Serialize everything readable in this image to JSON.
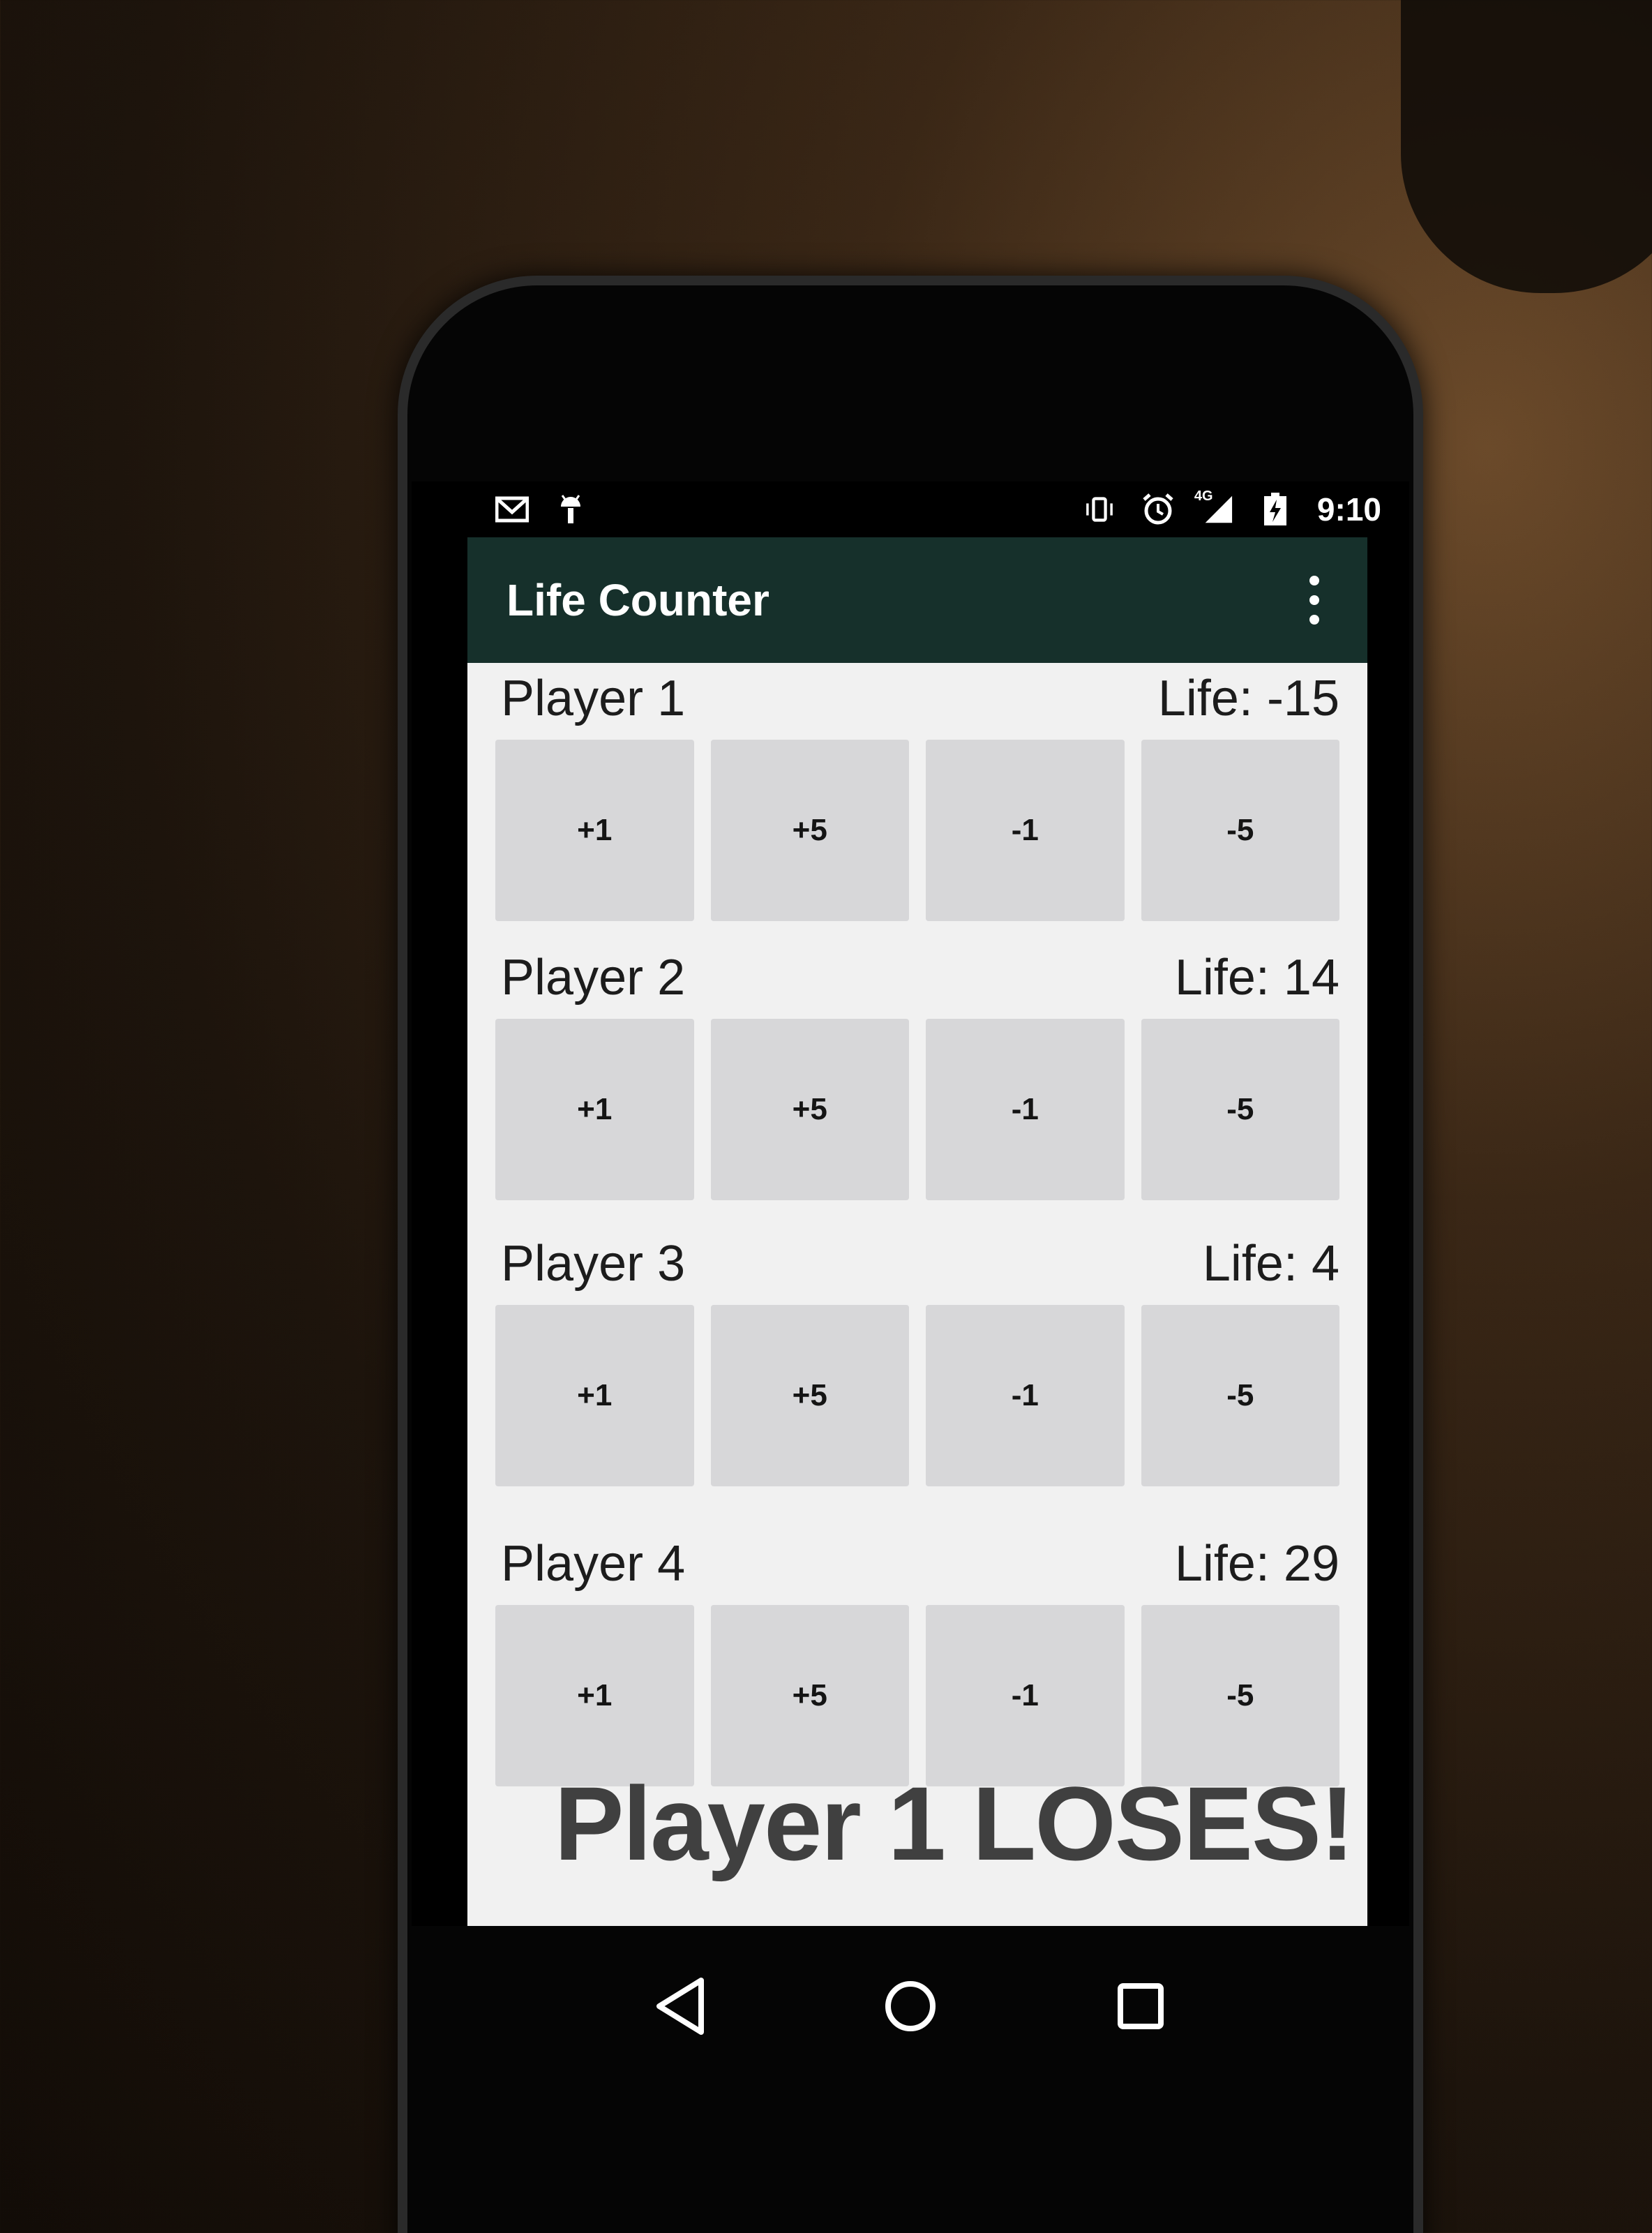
{
  "status_bar": {
    "time": "9:10",
    "left_icons": [
      "gmail-icon",
      "android-debug-icon"
    ],
    "right_icons": [
      "vibrate-icon",
      "alarm-icon",
      "signal-4g-icon",
      "battery-charging-icon"
    ],
    "network_label": "4G"
  },
  "app_bar": {
    "title": "Life Counter",
    "overflow_icon": "more-vert-icon",
    "color": "#16302b"
  },
  "players": [
    {
      "name": "Player 1",
      "life": "Life: -15",
      "buttons": [
        "+1",
        "+5",
        "-1",
        "-5"
      ]
    },
    {
      "name": "Player 2",
      "life": "Life: 14",
      "buttons": [
        "+1",
        "+5",
        "-1",
        "-5"
      ]
    },
    {
      "name": "Player 3",
      "life": "Life: 4",
      "buttons": [
        "+1",
        "+5",
        "-1",
        "-5"
      ]
    },
    {
      "name": "Player 4",
      "life": "Life: 29",
      "buttons": [
        "+1",
        "+5",
        "-1",
        "-5"
      ]
    }
  ],
  "banner": "Player 1 LOSES!",
  "nav_bar": [
    "back-icon",
    "home-icon",
    "recents-icon"
  ]
}
